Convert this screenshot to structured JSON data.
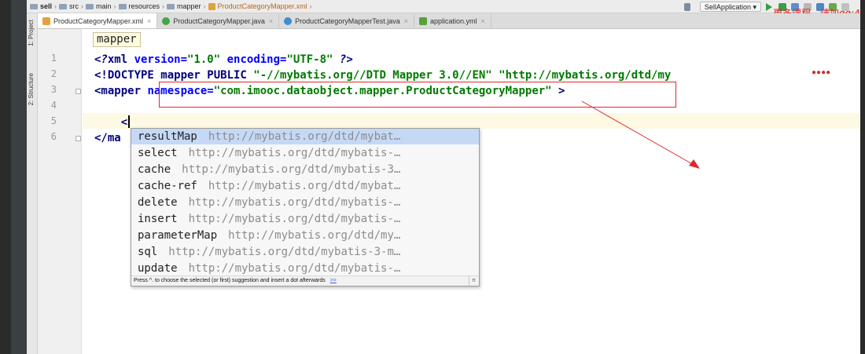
{
  "breadcrumbs": [
    {
      "label": "sell",
      "icon": "folder-icon"
    },
    {
      "label": "src",
      "icon": "folder-icon"
    },
    {
      "label": "main",
      "icon": "folder-icon"
    },
    {
      "label": "resources",
      "icon": "folder-icon"
    },
    {
      "label": "mapper",
      "icon": "folder-icon"
    },
    {
      "label": "ProductCategoryMapper.xml",
      "icon": "xml-file-icon"
    }
  ],
  "toolbar": {
    "run_config": "SellApplication"
  },
  "overlay_text": "更多课程，请加qq:4",
  "tool_windows": {
    "project": "1: Project",
    "structure": "2: Structure"
  },
  "tabs": [
    {
      "label": "ProductCategoryMapper.xml",
      "active": true,
      "icon_color": "#e2a33a"
    },
    {
      "label": "ProductCategoryMapper.java",
      "active": false,
      "icon_color": "#46a546"
    },
    {
      "label": "ProductCategoryMapperTest.java",
      "active": false,
      "icon_color": "#3d8fd1"
    },
    {
      "label": "application.yml",
      "active": false,
      "icon_color": "#5a9e3a"
    }
  ],
  "editor": {
    "tag_breadcrumb": "mapper",
    "line_numbers": [
      "1",
      "2",
      "3",
      "4",
      "5",
      "6"
    ],
    "lines": {
      "l1_open": "<?",
      "l1_xml": "xml ",
      "l1_version_attr": "version=",
      "l1_version_val": "\"1.0\"",
      "l1_encoding_attr": " encoding=",
      "l1_encoding_val": "\"UTF-8\"",
      "l1_close": " ?>",
      "l2_doctype": "<!DOCTYPE mapper PUBLIC ",
      "l2_public_id": "\"-//mybatis.org//DTD Mapper 3.0//EN\"",
      "l2_system_id": " \"http://mybatis.org/dtd/my",
      "l3_tag": "<mapper ",
      "l3_attr": "namespace=",
      "l3_val": "\"com.imooc.dataobject.mapper.ProductCategoryMapper\"",
      "l3_close": " >",
      "l5_text": "    <",
      "l6_text": "</ma"
    }
  },
  "completion": {
    "items": [
      {
        "name": "resultMap",
        "type": "http://mybatis.org/dtd/mybat…",
        "selected": true
      },
      {
        "name": "select",
        "type": "http://mybatis.org/dtd/mybatis-…",
        "selected": false
      },
      {
        "name": "cache",
        "type": "http://mybatis.org/dtd/mybatis-3…",
        "selected": false
      },
      {
        "name": "cache-ref",
        "type": "http://mybatis.org/dtd/mybat…",
        "selected": false
      },
      {
        "name": "delete",
        "type": "http://mybatis.org/dtd/mybatis-…",
        "selected": false
      },
      {
        "name": "insert",
        "type": "http://mybatis.org/dtd/mybatis-…",
        "selected": false
      },
      {
        "name": "parameterMap",
        "type": "http://mybatis.org/dtd/my…",
        "selected": false
      },
      {
        "name": "sql",
        "type": "http://mybatis.org/dtd/mybatis-3-m…",
        "selected": false
      },
      {
        "name": "update",
        "type": "http://mybatis.org/dtd/mybatis-…",
        "selected": false
      }
    ],
    "footer_hint": "Press ^. to choose the selected (or first) suggestion and insert a dot afterwards",
    "footer_link": ">>",
    "footer_pi": "π"
  },
  "colors": {
    "annotation_red": "#e0282c",
    "selection_blue": "#c5d9f6",
    "current_line": "#fdf9e3"
  }
}
